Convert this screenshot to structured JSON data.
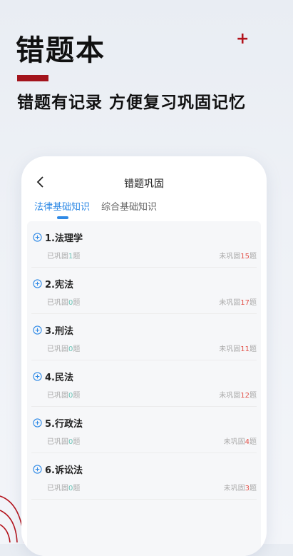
{
  "header": {
    "title": "错题本",
    "subtitle": "错题有记录  方便复习巩固记忆",
    "plus": "+"
  },
  "nav": {
    "title": "错题巩固"
  },
  "tabs": [
    {
      "label": "法律基础知识",
      "active": true
    },
    {
      "label": "综合基础知识",
      "active": false
    }
  ],
  "labels": {
    "done_prefix": "已巩固",
    "todo_prefix": "未巩固",
    "suffix": "题"
  },
  "items": [
    {
      "name": "1.法理学",
      "done": "1",
      "todo": "15"
    },
    {
      "name": "2.宪法",
      "done": "0",
      "todo": "17"
    },
    {
      "name": "3.刑法",
      "done": "0",
      "todo": "11"
    },
    {
      "name": "4.民法",
      "done": "0",
      "todo": "12"
    },
    {
      "name": "5.行政法",
      "done": "0",
      "todo": "4"
    },
    {
      "name": "6.诉讼法",
      "done": "0",
      "todo": "3"
    }
  ],
  "colors": {
    "accent": "#2f8ae6",
    "brand_red": "#a3141c",
    "done_num": "#6cc3b6",
    "todo_num": "#e2524a"
  },
  "icons": {
    "back": "chevron-left-icon",
    "item": "plus-circle-icon"
  }
}
